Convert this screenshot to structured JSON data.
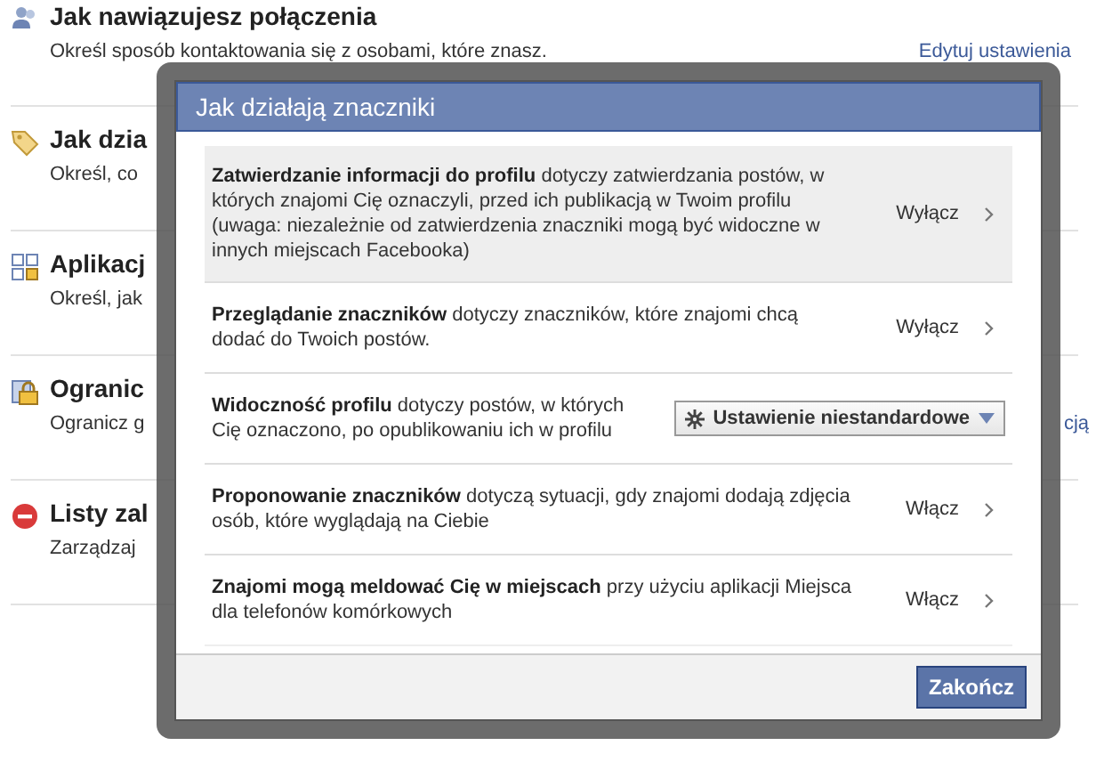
{
  "sections": [
    {
      "title": "Jak nawiązujesz połączenia",
      "description": "Określ sposób kontaktowania się z osobami, które znasz.",
      "link": "Edytuj ustawienia"
    },
    {
      "title": "Jak dzia",
      "description": "Określ, co"
    },
    {
      "title": "Aplikacj",
      "description": "Określ, jak"
    },
    {
      "title": "Ogranic",
      "description": "Ogranicz g",
      "link": "cją"
    },
    {
      "title": "Listy zal",
      "description": "Zarządzaj"
    }
  ],
  "dialog": {
    "title": "Jak działają znaczniki",
    "rows": [
      {
        "kind": "toggle",
        "highlighted": true,
        "text": "**Zatwierdzanie informacji do profilu** dotyczy zatwierdzania postów, w których znajomi Cię oznaczyli, przed ich publikacją w Twoim profilu (uwaga: niezależnie od zatwierdzenia znaczniki mogą być widoczne w innych miejscach Facebooka)",
        "action": "Wyłącz"
      },
      {
        "kind": "toggle",
        "highlighted": false,
        "text": "**Przeglądanie znaczników** dotyczy znaczników, które znajomi chcą dodać do Twoich postów.",
        "action": "Wyłącz"
      },
      {
        "kind": "dropdown",
        "highlighted": false,
        "text": "**Widoczność profilu** dotyczy postów, w których Cię oznaczono, po opublikowaniu ich w profilu",
        "action": "Ustawienie niestandardowe"
      },
      {
        "kind": "toggle",
        "highlighted": false,
        "text": "**Proponowanie znaczników** dotyczą sytuacji, gdy znajomi dodają zdjęcia osób, które wyglądają na Ciebie",
        "action": "Włącz"
      },
      {
        "kind": "toggle",
        "highlighted": false,
        "text": "**Znajomi mogą meldować Cię w miejscach** przy użyciu aplikacji Miejsca dla telefonów komórkowych",
        "action": "Włącz"
      }
    ],
    "button": "Zakończ"
  }
}
